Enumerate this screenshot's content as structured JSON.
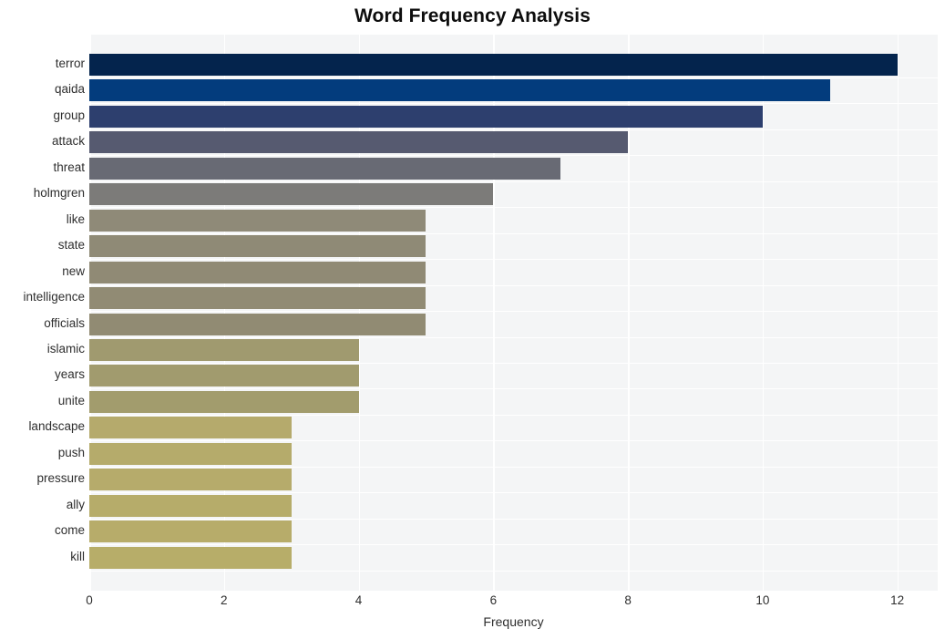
{
  "chart_data": {
    "type": "bar",
    "orientation": "horizontal",
    "title": "Word Frequency Analysis",
    "xlabel": "Frequency",
    "ylabel": "",
    "xlim": [
      0,
      12.6
    ],
    "xticks": [
      0,
      2,
      4,
      6,
      8,
      10,
      12
    ],
    "xtick_labels": [
      "0",
      "2",
      "4",
      "6",
      "8",
      "10",
      "12"
    ],
    "grid": true,
    "grid_axis": "both",
    "legend": null,
    "plot_background": "#f4f5f6",
    "page_background": "#ffffff",
    "gridline_color": "#ffffff",
    "categories": [
      "terror",
      "qaida",
      "group",
      "attack",
      "threat",
      "holmgren",
      "like",
      "state",
      "new",
      "intelligence",
      "officials",
      "islamic",
      "years",
      "unite",
      "landscape",
      "push",
      "pressure",
      "ally",
      "come",
      "kill"
    ],
    "values": [
      12,
      11,
      10,
      8,
      7,
      6,
      5,
      5,
      5,
      5,
      5,
      4,
      4,
      4,
      3,
      3,
      3,
      3,
      3,
      3
    ],
    "bar_colors": [
      "#04244d",
      "#033c7d",
      "#2d3f6e",
      "#565a70",
      "#686a74",
      "#7c7b79",
      "#8f8a78",
      "#8f8a76",
      "#908a75",
      "#918b74",
      "#918b73",
      "#a09a6f",
      "#a19b6e",
      "#a29c6d",
      "#b5aa6c",
      "#b5ab6b",
      "#b6ab6b",
      "#b6ac6a",
      "#b7ac6a",
      "#b7ad69"
    ]
  },
  "axis": {
    "tick_label_color": "#2e2e2e",
    "title_color": "#0d0d0d"
  }
}
